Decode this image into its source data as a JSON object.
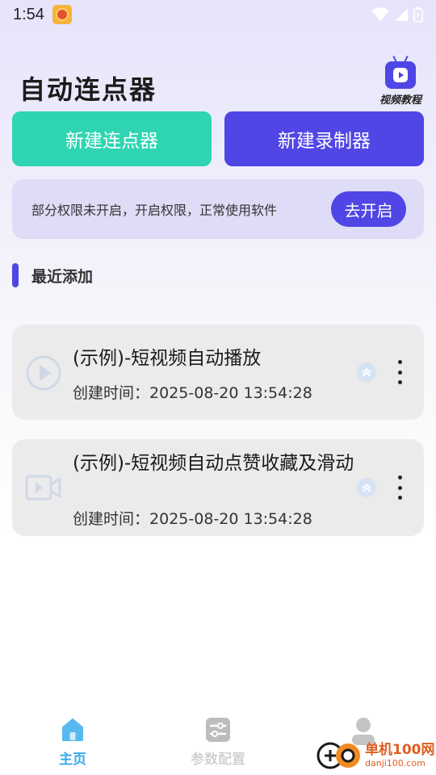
{
  "status_bar": {
    "time": "1:54"
  },
  "header": {
    "title": "自动连点器",
    "tutorial_label": "视频教程"
  },
  "actions": {
    "new_clicker": "新建连点器",
    "new_recorder": "新建录制器"
  },
  "permission": {
    "message": "部分权限未开启，开启权限，正常使用软件",
    "button": "去开启"
  },
  "recent": {
    "section_title": "最近添加",
    "items": [
      {
        "title": "(示例)-短视频自动播放",
        "created_label": "创建时间：",
        "created_at": "2025-08-20 13:54:28",
        "icon": "play-circle-icon"
      },
      {
        "title": "(示例)-短视频自动点赞收藏及滑动",
        "created_label": "创建时间：",
        "created_at": "2025-08-20 13:54:28",
        "icon": "video-camera-icon"
      }
    ]
  },
  "bottom_nav": {
    "items": [
      {
        "label": "主页",
        "icon": "home-icon",
        "active": true
      },
      {
        "label": "参数配置",
        "icon": "settings-sliders-icon",
        "active": false
      },
      {
        "label": "",
        "icon": "profile-icon",
        "active": false
      }
    ]
  },
  "watermark": {
    "name": "单机100网",
    "url": "danji100.com"
  },
  "colors": {
    "accent": "#4f46e5",
    "teal": "#2fd5b3",
    "nav_active": "#38a9e8"
  }
}
